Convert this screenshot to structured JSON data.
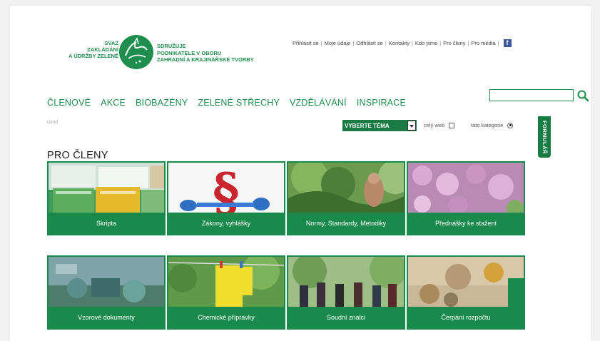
{
  "brand": {
    "left_lines": [
      "SVAZ",
      "ZAKLÁDÁNÍ",
      "A ÚDRŽBY ZELENĚ"
    ],
    "right_lines": [
      "SDRUŽUJE",
      "PODNIKATELE V OBORU",
      "ZAHRADNÍ A KRAJINÁŘSKÉ TVORBY"
    ],
    "color": "#1f8d4d"
  },
  "toplinks": [
    "Přihlásit se",
    "Moje údaje",
    "Odhlásit se",
    "Kontakty",
    "Kdo jsme",
    "Pro členy",
    "Pro média"
  ],
  "nav": [
    "ČLENOVÉ",
    "AKCE",
    "BIOBAZÉNY",
    "ZELENÉ STŘECHY",
    "VZDĚLÁVÁNÍ",
    "INSPIRACE"
  ],
  "search": {
    "placeholder": ""
  },
  "breadcrumb": "úvod",
  "filter": {
    "select_label": "VYBERTE TÉMA",
    "scope_all": "celý web",
    "scope_category": "tato kategorie"
  },
  "form_tab": "FORMULÁŘ",
  "page_title": "PRO ČLENY",
  "tiles": [
    {
      "label": "Skripta"
    },
    {
      "label": "Zákony, vyhlášky"
    },
    {
      "label": "Normy, Standardy, Metodiky"
    },
    {
      "label": "Přednášky ke stažení"
    },
    {
      "label": "Vzorové dokumenty"
    },
    {
      "label": "Chemické přípravky"
    },
    {
      "label": "Soudní znalci"
    },
    {
      "label": "Čerpání rozpočtu"
    }
  ],
  "colors": {
    "accent": "#1a8a4c",
    "facebook": "#3b5998"
  }
}
